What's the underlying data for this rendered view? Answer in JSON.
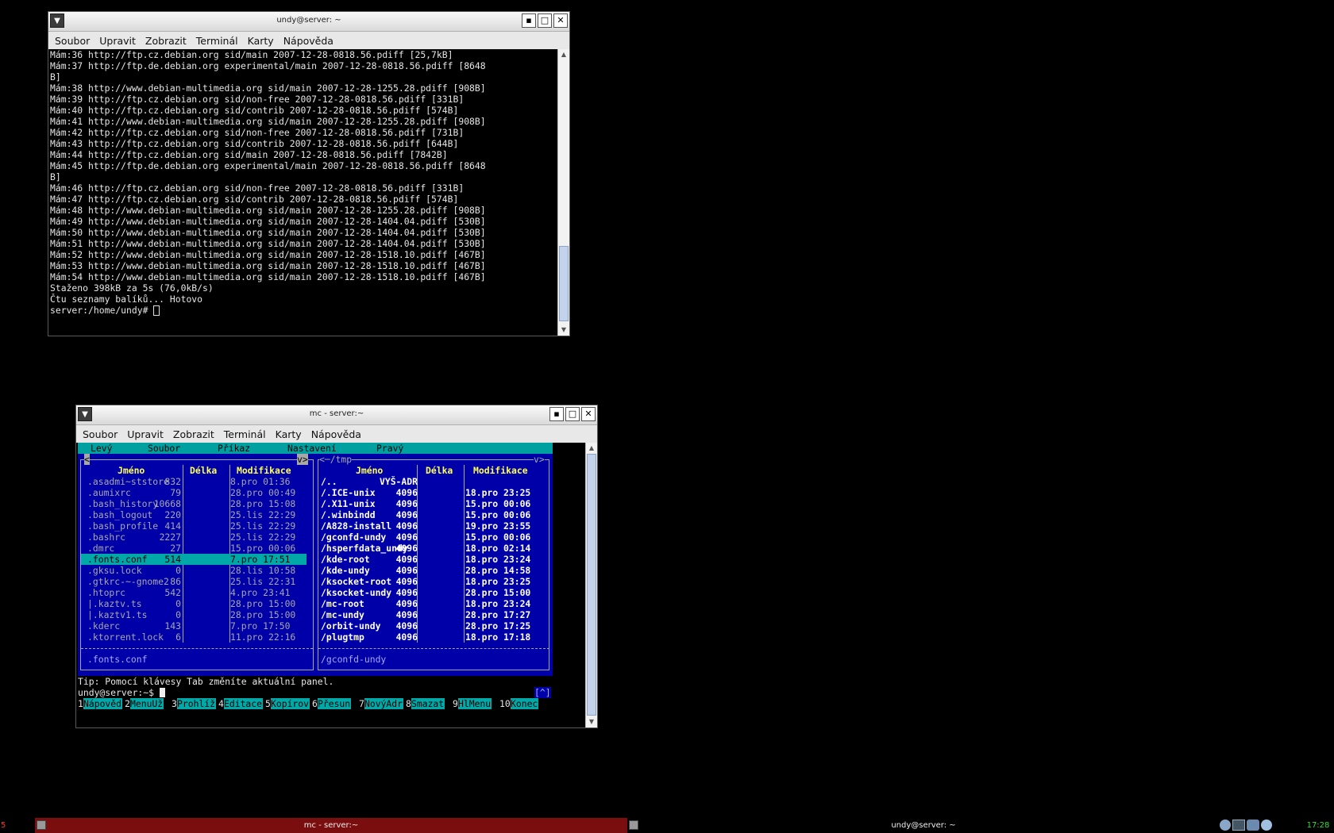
{
  "win1": {
    "title": "undy@server: ~",
    "menu": [
      "Soubor",
      "Upravit",
      "Zobrazit",
      "Terminál",
      "Karty",
      "Nápověda"
    ],
    "lines": [
      "Mám:36 http://ftp.cz.debian.org sid/main 2007-12-28-0818.56.pdiff [25,7kB]",
      "Mám:37 http://ftp.de.debian.org experimental/main 2007-12-28-0818.56.pdiff [8648",
      "B]",
      "Mám:38 http://www.debian-multimedia.org sid/main 2007-12-28-1255.28.pdiff [908B]",
      "Mám:39 http://ftp.cz.debian.org sid/non-free 2007-12-28-0818.56.pdiff [331B]",
      "Mám:40 http://ftp.cz.debian.org sid/contrib 2007-12-28-0818.56.pdiff [574B]",
      "Mám:41 http://www.debian-multimedia.org sid/main 2007-12-28-1255.28.pdiff [908B]",
      "Mám:42 http://ftp.cz.debian.org sid/non-free 2007-12-28-0818.56.pdiff [731B]",
      "Mám:43 http://ftp.cz.debian.org sid/contrib 2007-12-28-0818.56.pdiff [644B]",
      "Mám:44 http://ftp.cz.debian.org sid/main 2007-12-28-0818.56.pdiff [7842B]",
      "Mám:45 http://ftp.de.debian.org experimental/main 2007-12-28-0818.56.pdiff [8648",
      "B]",
      "Mám:46 http://ftp.cz.debian.org sid/non-free 2007-12-28-0818.56.pdiff [331B]",
      "Mám:47 http://ftp.cz.debian.org sid/contrib 2007-12-28-0818.56.pdiff [574B]",
      "Mám:48 http://www.debian-multimedia.org sid/main 2007-12-28-1255.28.pdiff [908B]",
      "Mám:49 http://www.debian-multimedia.org sid/main 2007-12-28-1404.04.pdiff [530B]",
      "Mám:50 http://www.debian-multimedia.org sid/main 2007-12-28-1404.04.pdiff [530B]",
      "Mám:51 http://www.debian-multimedia.org sid/main 2007-12-28-1404.04.pdiff [530B]",
      "Mám:52 http://www.debian-multimedia.org sid/main 2007-12-28-1518.10.pdiff [467B]",
      "Mám:53 http://www.debian-multimedia.org sid/main 2007-12-28-1518.10.pdiff [467B]",
      "Mám:54 http://www.debian-multimedia.org sid/main 2007-12-28-1518.10.pdiff [467B]",
      "Staženo 398kB za 5s (76,0kB/s)",
      "Čtu seznamy balíků... Hotovo"
    ],
    "prompt": "server:/home/undy# "
  },
  "win2": {
    "title": "mc - server:~",
    "menu": [
      "Soubor",
      "Upravit",
      "Zobrazit",
      "Terminál",
      "Karty",
      "Nápověda"
    ],
    "mc_menu": [
      "Levý",
      "Soubor",
      "Příkaz",
      "Nastavení",
      "Pravý"
    ],
    "left_top_left": "<",
    "left_top_right": "v>",
    "right_path": "<─/tmp",
    "right_top_right": "v>",
    "headers": {
      "name": "Jméno",
      "size": "Délka",
      "mod": "Modifikace"
    },
    "left_files": [
      {
        "name": ".asadmi~ststore",
        "size": "832",
        "mod": "8.pro 01:36"
      },
      {
        "name": ".aumixrc",
        "size": "79",
        "mod": "28.pro 00:49"
      },
      {
        "name": ".bash_history",
        "size": "10668",
        "mod": "28.pro 15:08"
      },
      {
        "name": ".bash_logout",
        "size": "220",
        "mod": "25.lis 22:29"
      },
      {
        "name": ".bash_profile",
        "size": "414",
        "mod": "25.lis 22:29"
      },
      {
        "name": ".bashrc",
        "size": "2227",
        "mod": "25.lis 22:29"
      },
      {
        "name": ".dmrc",
        "size": "27",
        "mod": "15.pro 00:06"
      },
      {
        "name": ".fonts.conf",
        "size": "514",
        "mod": "7.pro 17:51"
      },
      {
        "name": ".gksu.lock",
        "size": "0",
        "mod": "28.lis 10:58"
      },
      {
        "name": ".gtkrc-~-gnome2",
        "size": "86",
        "mod": "25.lis 22:31"
      },
      {
        "name": ".htoprc",
        "size": "542",
        "mod": "4.pro 23:41"
      },
      {
        "name": "|.kaztv.ts",
        "size": "0",
        "mod": "28.pro 15:00"
      },
      {
        "name": "|.kaztv1.ts",
        "size": "0",
        "mod": "28.pro 15:00"
      },
      {
        "name": ".kderc",
        "size": "143",
        "mod": "7.pro 17:50"
      },
      {
        "name": ".ktorrent.lock",
        "size": "6",
        "mod": "11.pro 22:16"
      }
    ],
    "left_selected_index": 7,
    "left_footer": ".fonts.conf",
    "right_files": [
      {
        "name": "/..",
        "size": "VYŠ-ADR",
        "mod": ""
      },
      {
        "name": "/.ICE-unix",
        "size": "4096",
        "mod": "18.pro 23:25"
      },
      {
        "name": "/.X11-unix",
        "size": "4096",
        "mod": "15.pro 00:06"
      },
      {
        "name": "/.winbindd",
        "size": "4096",
        "mod": "15.pro 00:06"
      },
      {
        "name": "/A828-install",
        "size": "4096",
        "mod": "19.pro 23:55"
      },
      {
        "name": "/gconfd-undy",
        "size": "4096",
        "mod": "15.pro 00:06"
      },
      {
        "name": "/hsperfdata_undy",
        "size": "4096",
        "mod": "18.pro 02:14"
      },
      {
        "name": "/kde-root",
        "size": "4096",
        "mod": "18.pro 23:24"
      },
      {
        "name": "/kde-undy",
        "size": "4096",
        "mod": "28.pro 14:58"
      },
      {
        "name": "/ksocket-root",
        "size": "4096",
        "mod": "18.pro 23:25"
      },
      {
        "name": "/ksocket-undy",
        "size": "4096",
        "mod": "28.pro 15:00"
      },
      {
        "name": "/mc-root",
        "size": "4096",
        "mod": "18.pro 23:24"
      },
      {
        "name": "/mc-undy",
        "size": "4096",
        "mod": "28.pro 17:27"
      },
      {
        "name": "/orbit-undy",
        "size": "4096",
        "mod": "28.pro 17:25"
      },
      {
        "name": "/plugtmp",
        "size": "4096",
        "mod": "18.pro 17:18"
      }
    ],
    "right_footer": "/gconfd-undy",
    "tip": "Tip: Pomocí klávesy Tab změníte aktuální panel.",
    "prompt": "undy@server:~$ ",
    "prompt_right": "[^]",
    "fkeys": [
      {
        "num": "1",
        "label": "Nápověd"
      },
      {
        "num": "2",
        "label": "MenuUž"
      },
      {
        "num": "3",
        "label": "Prohlíž"
      },
      {
        "num": "4",
        "label": "Editace"
      },
      {
        "num": "5",
        "label": "Kopírov"
      },
      {
        "num": "6",
        "label": "Přesun"
      },
      {
        "num": "7",
        "label": "NovýAdr"
      },
      {
        "num": "8",
        "label": "Smazat"
      },
      {
        "num": "9",
        "label": "HlMenu"
      },
      {
        "num": "10",
        "label": "Konec"
      }
    ]
  },
  "taskbar": {
    "workspace": "5",
    "task1": "mc - server:~",
    "task2": "undy@server: ~",
    "clock": "17:28"
  }
}
